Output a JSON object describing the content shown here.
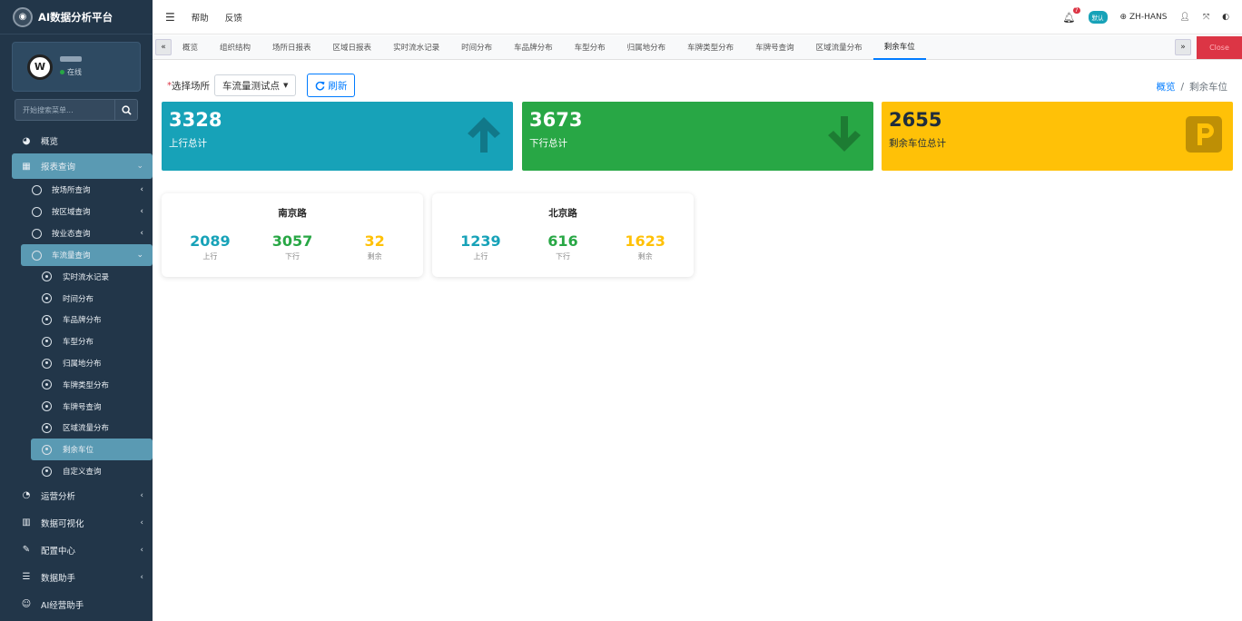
{
  "app": {
    "title": "AI数据分析平台"
  },
  "user": {
    "status": "在线"
  },
  "sidebar": {
    "search_placeholder": "开始搜索菜单...",
    "items": [
      {
        "label": "概览",
        "icon": "dashboard-icon"
      },
      {
        "label": "报表查询",
        "icon": "grid-icon",
        "expanded": true
      },
      {
        "label": "运营分析",
        "icon": "pie-chart-icon"
      },
      {
        "label": "数据可视化",
        "icon": "bar-chart-icon"
      },
      {
        "label": "配置中心",
        "icon": "edit-icon"
      },
      {
        "label": "数据助手",
        "icon": "database-icon"
      },
      {
        "label": "AI经营助手",
        "icon": "robot-icon"
      }
    ],
    "report_sub": [
      "按场所查询",
      "按区域查询",
      "按业态查询",
      "车流量查询"
    ],
    "traffic_sub": [
      "实时流水记录",
      "时间分布",
      "车品牌分布",
      "车型分布",
      "归属地分布",
      "车牌类型分布",
      "车牌号查询",
      "区域流量分布",
      "剩余车位",
      "自定义查询"
    ]
  },
  "topbar": {
    "help": "帮助",
    "feedback": "反馈",
    "notification_count": "7",
    "default_pill": "默认",
    "language": "ZH-HANS"
  },
  "tabs": [
    "概览",
    "组织结构",
    "场所日报表",
    "区域日报表",
    "实时流水记录",
    "时间分布",
    "车品牌分布",
    "车型分布",
    "归属地分布",
    "车牌类型分布",
    "车牌号查询",
    "区域流量分布",
    "剩余车位"
  ],
  "active_tab": "剩余车位",
  "close_label": "Close",
  "filter": {
    "required_mark": "*",
    "label": "选择场所",
    "selected": "车流量测试点",
    "refresh": "刷新"
  },
  "breadcrumb": {
    "home": "概览",
    "separator": "/",
    "current": "剩余车位"
  },
  "summary": [
    {
      "value": "3328",
      "label": "上行总计",
      "color": "#17a2b8",
      "icon": "arrow-up-icon"
    },
    {
      "value": "3673",
      "label": "下行总计",
      "color": "#28a745",
      "icon": "arrow-down-icon"
    },
    {
      "value": "2655",
      "label": "剩余车位总计",
      "color": "#ffc107",
      "icon": "parking-icon"
    }
  ],
  "sites": [
    {
      "name": "南京路",
      "up": "2089",
      "down": "3057",
      "left": "32",
      "up_label": "上行",
      "down_label": "下行",
      "left_label": "剩余"
    },
    {
      "name": "北京路",
      "up": "1239",
      "down": "616",
      "left": "1623",
      "up_label": "上行",
      "down_label": "下行",
      "left_label": "剩余"
    }
  ]
}
